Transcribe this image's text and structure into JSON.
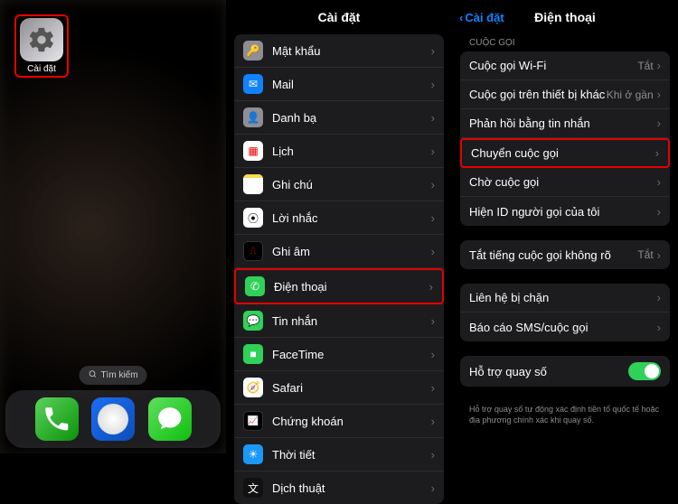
{
  "panel1": {
    "app_label": "Cài đặt",
    "search_label": "Tìm kiếm"
  },
  "panel2": {
    "title": "Cài đặt",
    "items": [
      {
        "label": "Mật khẩu"
      },
      {
        "label": "Mail"
      },
      {
        "label": "Danh bạ"
      },
      {
        "label": "Lịch"
      },
      {
        "label": "Ghi chú"
      },
      {
        "label": "Lời nhắc"
      },
      {
        "label": "Ghi âm"
      },
      {
        "label": "Điện thoại"
      },
      {
        "label": "Tin nhắn"
      },
      {
        "label": "FaceTime"
      },
      {
        "label": "Safari"
      },
      {
        "label": "Chứng khoán"
      },
      {
        "label": "Thời tiết"
      },
      {
        "label": "Dịch thuật"
      }
    ]
  },
  "panel3": {
    "back": "Cài đặt",
    "title": "Điện thoại",
    "section_header": "CUỘC GỌI",
    "rows_calls": [
      {
        "label": "Cuộc gọi Wi-Fi",
        "value": "Tắt"
      },
      {
        "label": "Cuộc gọi trên thiết bị khác",
        "value": "Khi ở gần"
      },
      {
        "label": "Phản hồi bằng tin nhắn",
        "value": ""
      },
      {
        "label": "Chuyển cuộc gọi",
        "value": ""
      },
      {
        "label": "Chờ cuộc gọi",
        "value": ""
      },
      {
        "label": "Hiện ID người gọi của tôi",
        "value": ""
      }
    ],
    "rows_silence": [
      {
        "label": "Tắt tiếng cuộc gọi không rõ",
        "value": "Tắt"
      }
    ],
    "rows_blocked": [
      {
        "label": "Liên hệ bị chặn",
        "value": ""
      },
      {
        "label": "Báo cáo SMS/cuộc gọi",
        "value": ""
      }
    ],
    "dial_assist_label": "Hỗ trợ quay số",
    "dial_assist_note": "Hỗ trợ quay số tự động xác định tiền tố quốc tế hoặc địa phương chính xác khi quay số."
  }
}
